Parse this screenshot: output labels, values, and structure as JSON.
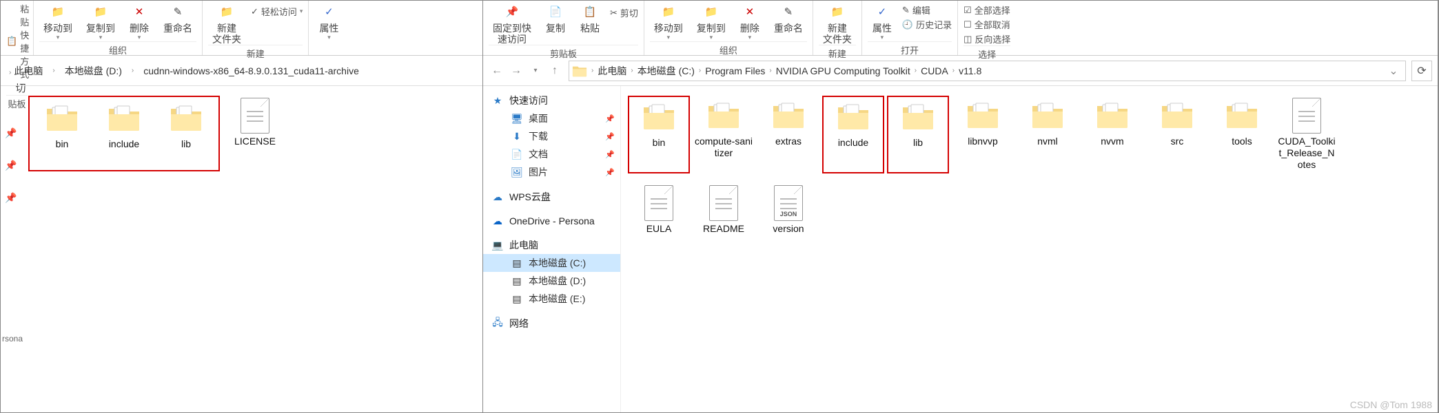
{
  "left": {
    "ribbon": {
      "paste_shortcut": "粘贴快捷方式",
      "cut": "切",
      "move_to": "移动到",
      "copy_to": "复制到",
      "delete": "删除",
      "rename": "重命名",
      "new_folder": "新建\n文件夹",
      "easy_access": "轻松访问",
      "properties": "属性",
      "group_clipboard": "贴板",
      "group_organize": "组织",
      "group_new": "新建"
    },
    "breadcrumb": [
      "此电脑",
      "本地磁盘 (D:)",
      "cudnn-windows-x86_64-8.9.0.131_cuda11-archive"
    ],
    "quick_access_label": "rsona",
    "folders": [
      {
        "name": "bin",
        "type": "folder"
      },
      {
        "name": "include",
        "type": "folder"
      },
      {
        "name": "lib",
        "type": "folder"
      }
    ],
    "files": [
      {
        "name": "LICENSE",
        "type": "file"
      }
    ]
  },
  "right": {
    "ribbon": {
      "pin_quick": "固定到快\n速访问",
      "copy": "复制",
      "paste": "粘贴",
      "cut": "剪切",
      "move_to": "移动到",
      "copy_to": "复制到",
      "delete": "删除",
      "rename": "重命名",
      "new_folder": "新建\n文件夹",
      "properties": "属性",
      "edit": "编辑",
      "history": "历史记录",
      "select_all": "全部选择",
      "select_none": "全部取消",
      "invert": "反向选择",
      "group_clipboard": "剪贴板",
      "group_organize": "组织",
      "group_new": "新建",
      "group_open": "打开",
      "group_select": "选择"
    },
    "breadcrumb": [
      "此电脑",
      "本地磁盘 (C:)",
      "Program Files",
      "NVIDIA GPU Computing Toolkit",
      "CUDA",
      "v11.8"
    ],
    "nav": {
      "quick_access": "快速访问",
      "desktop": "桌面",
      "downloads": "下载",
      "documents": "文档",
      "pictures": "图片",
      "wps": "WPS云盘",
      "onedrive": "OneDrive - Persona",
      "this_pc": "此电脑",
      "drive_c": "本地磁盘 (C:)",
      "drive_d": "本地磁盘 (D:)",
      "drive_e": "本地磁盘 (E:)",
      "network": "网络"
    },
    "items_row1": [
      {
        "name": "bin",
        "type": "folder",
        "boxed": true
      },
      {
        "name": "compute-sanitizer",
        "type": "folder"
      },
      {
        "name": "extras",
        "type": "folder"
      },
      {
        "name": "include",
        "type": "folder",
        "boxed": true
      },
      {
        "name": "lib",
        "type": "folder",
        "boxed": true
      },
      {
        "name": "libnvvp",
        "type": "folder-eclipse"
      },
      {
        "name": "nvml",
        "type": "folder"
      },
      {
        "name": "nvvm",
        "type": "folder"
      },
      {
        "name": "src",
        "type": "folder"
      },
      {
        "name": "tools",
        "type": "folder-green"
      },
      {
        "name": "CUDA_Toolkit_Release_Notes",
        "type": "file"
      }
    ],
    "items_row2": [
      {
        "name": "EULA",
        "type": "file"
      },
      {
        "name": "README",
        "type": "file"
      },
      {
        "name": "version",
        "type": "file-json",
        "badge": "JSON"
      }
    ]
  },
  "watermark": "CSDN @Tom 1988"
}
